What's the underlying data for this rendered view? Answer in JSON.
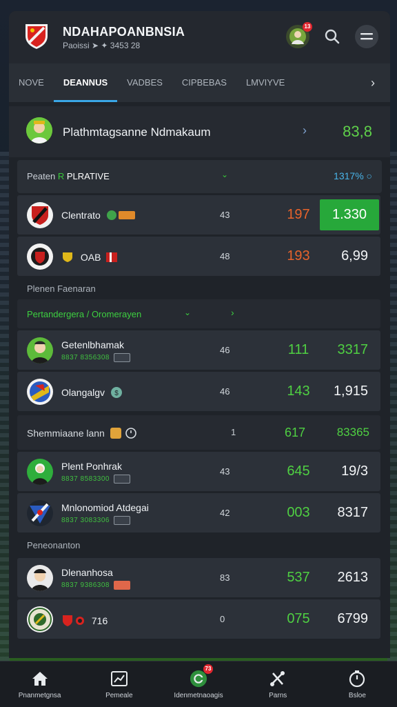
{
  "header": {
    "title": "NDAHAPOANBNSIA",
    "subtitle": "Paoissi ➤ ✦ 3453 28",
    "profile_badge": "13"
  },
  "tabs": [
    {
      "label": "NOVE",
      "active": false
    },
    {
      "label": "DEANNUS",
      "active": true
    },
    {
      "label": "VADBES",
      "active": false
    },
    {
      "label": "CIPBEBAS",
      "active": false
    },
    {
      "label": "LMVIYVE",
      "active": false
    }
  ],
  "featured": {
    "name": "Plathmtagsanne Ndmakaum",
    "odds": "83,8"
  },
  "filter": {
    "prefix": "Peaten",
    "value": "PLRATIVE",
    "value_mark": "R",
    "percent": "1317% ○"
  },
  "rows_a": [
    {
      "name": "Clentrato",
      "mid": "43",
      "odd": "197",
      "value": "1.330",
      "highlight": true
    },
    {
      "name": "OAB",
      "mid": "48",
      "odd": "193",
      "value": "6,99",
      "highlight": false
    }
  ],
  "section1": "Plenen Faenaran",
  "sub_filter": "Pertandergera / Oromerayen",
  "rows_b": [
    {
      "name": "Getenlbhamak",
      "sub": "8837 8356308",
      "mid": "46",
      "odd": "111",
      "value": "3317"
    },
    {
      "name": "Olangalgv",
      "sub": "",
      "mid": "46",
      "odd": "143",
      "value": "1,915"
    }
  ],
  "group_row": {
    "name": "Shemmiaane lann",
    "mid": "1",
    "odd": "617",
    "value": "83365"
  },
  "rows_c": [
    {
      "name": "Plent Ponhrak",
      "sub": "8837 8583300",
      "mid": "43",
      "odd": "645",
      "value": "19/3"
    },
    {
      "name": "Mnlonomiod Atdegai",
      "sub": "8837 3083306",
      "mid": "42",
      "odd": "003",
      "value": "8317"
    }
  ],
  "section2": "Peneonanton",
  "rows_d": [
    {
      "name": "Dlenanhosa",
      "sub": "8837 9386308",
      "mid": "83",
      "odd": "537",
      "value": "2613"
    },
    {
      "name": "716",
      "sub": "",
      "mid": "0",
      "odd": "075",
      "value": "6799"
    }
  ],
  "nav": [
    {
      "label": "Pnanmetgnsa",
      "icon": "home-icon"
    },
    {
      "label": "Pemeale",
      "icon": "stats-icon"
    },
    {
      "label": "Idenmetnaoagis",
      "icon": "live-icon",
      "badge": "73"
    },
    {
      "label": "Parns",
      "icon": "tools-icon"
    },
    {
      "label": "Bsloe",
      "icon": "timer-icon"
    }
  ],
  "colors": {
    "accent_green": "#4fd042",
    "accent_orange": "#e8632b",
    "accent_blue": "#3aa7e8"
  }
}
